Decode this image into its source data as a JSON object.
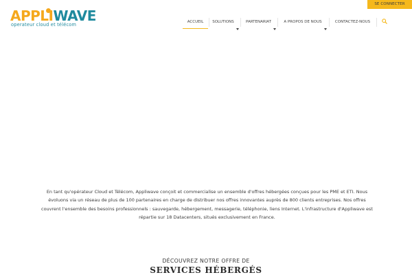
{
  "header": {
    "login_label": "SE CONNECTER",
    "logo": {
      "word_part1": "APPLI",
      "word_part2": "WAVE",
      "tagline": "operateur cloud et télécom"
    },
    "nav": [
      {
        "label": "ACCUEIL",
        "active": true,
        "has_dropdown": false
      },
      {
        "label": "SOLUTIONS",
        "active": false,
        "has_dropdown": true
      },
      {
        "label": "PARTENARIAT",
        "active": false,
        "has_dropdown": true
      },
      {
        "label": "A PROPOS DE NOUS",
        "active": false,
        "has_dropdown": true
      },
      {
        "label": "CONTACTEZ-NOUS",
        "active": false,
        "has_dropdown": false
      }
    ],
    "search_icon": "search-icon"
  },
  "intro": {
    "text": "En tant qu'opérateur Cloud et Télécom, Appliwave conçoit et commercialise un ensemble d'offres hébergées conçues pour les PME et ETI. Nous évoluons via un réseau de plus de 100 partenaires en charge de distribuer nos offres innovantes auprès de 800 clients entreprises. Nos offres couvrent l'ensemble des besoins professionnels : sauvegarde, hébergement, messagerie, téléphonie, liens Internet. L'infrastructure d'Appliwave est répartie sur 18 Datacenters, situés exclusivement en France."
  },
  "section": {
    "subtitle": "DÉCOUVREZ NOTRE OFFRE DE",
    "title": "SERVICES HÉBERGÉS"
  },
  "colors": {
    "accent": "#f5b81c",
    "brand_teal": "#1f8a9e",
    "brand_orange": "#f5a81c"
  }
}
